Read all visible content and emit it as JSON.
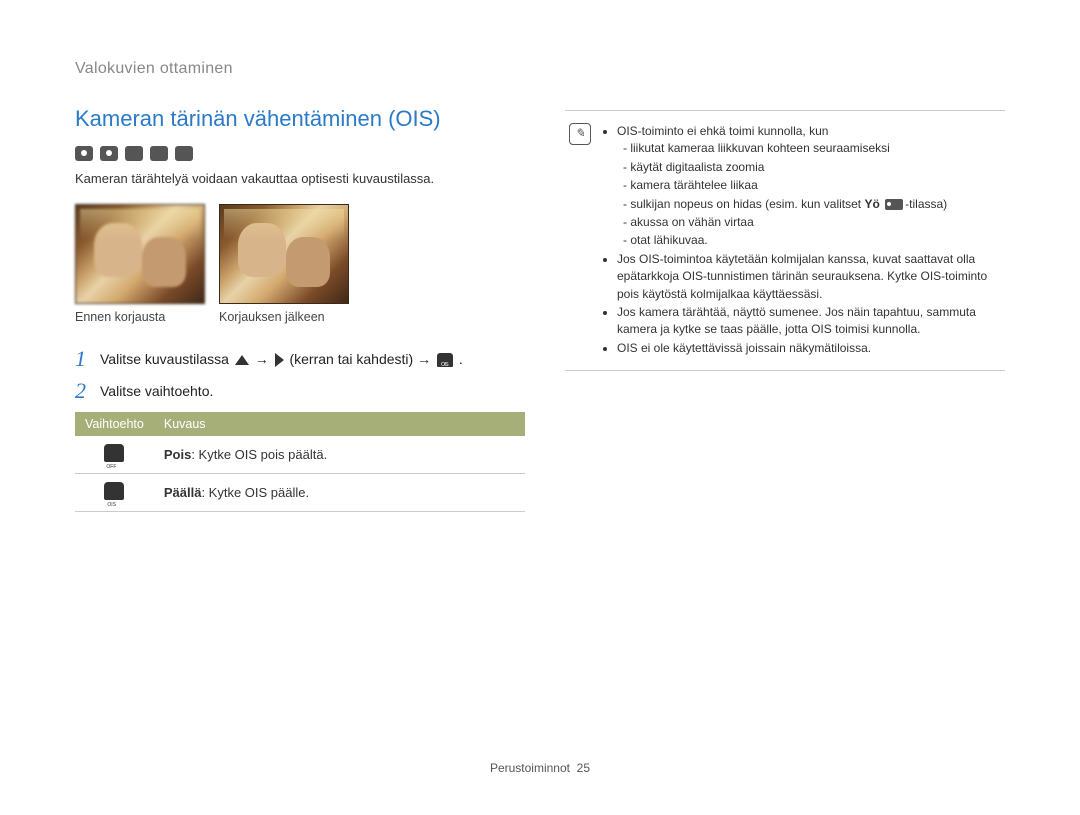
{
  "breadcrumb": "Valokuvien ottaminen",
  "title": "Kameran tärinän vähentäminen (OIS)",
  "mode_icons": [
    "camera-icon",
    "camera-p-icon",
    "scene-icon",
    "movie-icon",
    "smart-movie-icon"
  ],
  "intro": "Kameran tärähtelyä voidaan vakauttaa optisesti kuvaustilassa.",
  "images": {
    "before_caption": "Ennen korjausta",
    "after_caption": "Korjauksen jälkeen"
  },
  "steps": [
    {
      "num": "1",
      "parts": {
        "p1": "Valitse kuvaustilassa ",
        "p2": " → ",
        "p3": " (kerran tai kahdesti) → ",
        "p4": "."
      }
    },
    {
      "num": "2",
      "text": "Valitse vaihtoehto."
    }
  ],
  "table": {
    "headers": {
      "opt": "Vaihtoehto",
      "desc": "Kuvaus"
    },
    "rows": [
      {
        "icon": "hand-off-icon",
        "label": "Pois",
        "desc": ": Kytke OIS pois päältä."
      },
      {
        "icon": "hand-ois-icon",
        "label": "Päällä",
        "desc": ": Kytke OIS päälle."
      }
    ]
  },
  "note": {
    "b1": "OIS-toiminto ei ehkä toimi kunnolla, kun",
    "b1_sub": [
      "liikutat kameraa liikkuvan kohteen seuraamiseksi",
      "käytät digitaalista zoomia",
      "kamera tärähtelee liikaa",
      {
        "pre": "sulkijan nopeus on hidas (esim. kun valitset ",
        "bold": "Yö",
        "post": "-tilassa)"
      },
      "akussa on vähän virtaa",
      "otat lähikuvaa."
    ],
    "b2": "Jos OIS-toimintoa käytetään kolmijalan kanssa, kuvat saattavat olla epätarkkoja OIS-tunnistimen tärinän seurauksena. Kytke OIS-toiminto pois käytöstä kolmijalkaa käyttäessäsi.",
    "b3": "Jos kamera tärähtää, näyttö sumenee. Jos näin tapahtuu, sammuta kamera ja kytke se taas päälle, jotta OIS toimisi kunnolla.",
    "b4": "OIS ei ole käytettävissä joissain näkymätiloissa."
  },
  "footer": {
    "section": "Perustoiminnot",
    "page": "25"
  }
}
